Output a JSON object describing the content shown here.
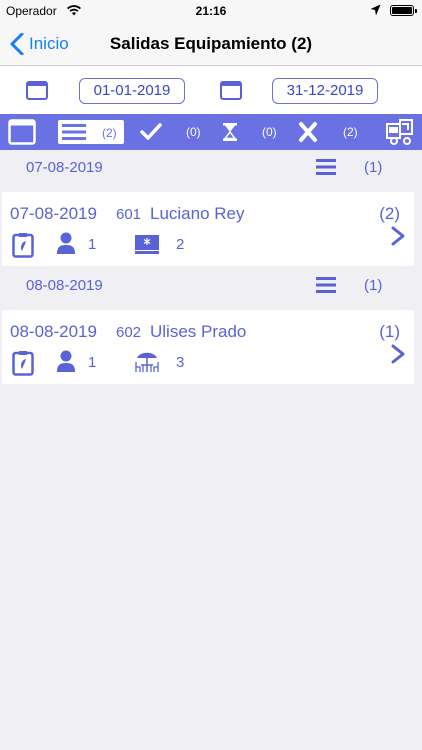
{
  "status_bar": {
    "carrier": "Operador",
    "time": "21:16"
  },
  "nav": {
    "back_label": "Inicio",
    "title": "Salidas Equipamiento (2)"
  },
  "filter": {
    "date_from": "01-01-2019",
    "date_to": "31-12-2019"
  },
  "toolbar": {
    "list_count": "(2)",
    "check_count": "(0)",
    "pending_count": "(0)",
    "cancel_count": "(2)"
  },
  "groups": [
    {
      "date": "07-08-2019",
      "count": "(1)",
      "items": [
        {
          "date": "07-08-2019",
          "number": "601",
          "name": "Luciano Rey",
          "count": "(2)",
          "persons": "1",
          "equipment_icon": "screen-icon",
          "equipment_count": "2"
        }
      ]
    },
    {
      "date": "08-08-2019",
      "count": "(1)",
      "items": [
        {
          "date": "08-08-2019",
          "number": "602",
          "name": "Ulises Prado",
          "count": "(1)",
          "persons": "1",
          "equipment_icon": "table-umbrella-icon",
          "equipment_count": "3"
        }
      ]
    }
  ],
  "colors": {
    "accent": "#6a72e3",
    "text_accent": "#5a63d6",
    "ios_blue": "#157efb",
    "background": "#efeff4"
  }
}
